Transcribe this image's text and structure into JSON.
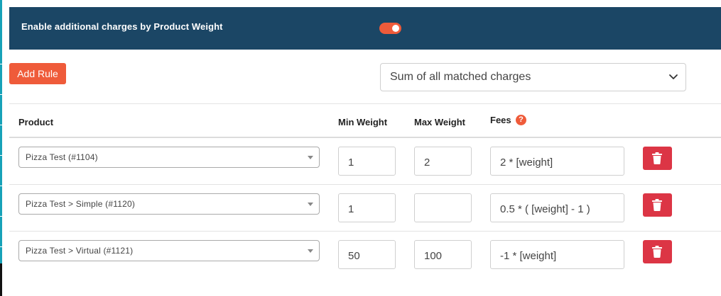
{
  "header": {
    "label": "Enable additional charges by Product Weight",
    "toggle_state": "on",
    "toggle_color": "#ef5b3a",
    "background": "#1b4665"
  },
  "toolbar": {
    "add_rule_label": "Add Rule",
    "mode_select_value": "Sum of all matched charges"
  },
  "table": {
    "columns": [
      "Product",
      "Min Weight",
      "Max Weight",
      "Fees"
    ],
    "help_icon": "?",
    "rows": [
      {
        "product": "Pizza Test (#1104)",
        "min": "1",
        "max": "2",
        "fees": "2 * [weight]"
      },
      {
        "product": "Pizza Test > Simple (#1120)",
        "min": "1",
        "max": "",
        "fees": "0.5 * ( [weight] - 1 )"
      },
      {
        "product": "Pizza Test > Virtual (#1121)",
        "min": "50",
        "max": "100",
        "fees": "-1 * [weight]"
      }
    ]
  },
  "icons": {
    "delete": "trash-icon",
    "select_arrow": "chevron-down-icon",
    "help": "question-circle-icon"
  },
  "colors": {
    "accent": "#ef5b3a",
    "danger": "#dc3545"
  }
}
